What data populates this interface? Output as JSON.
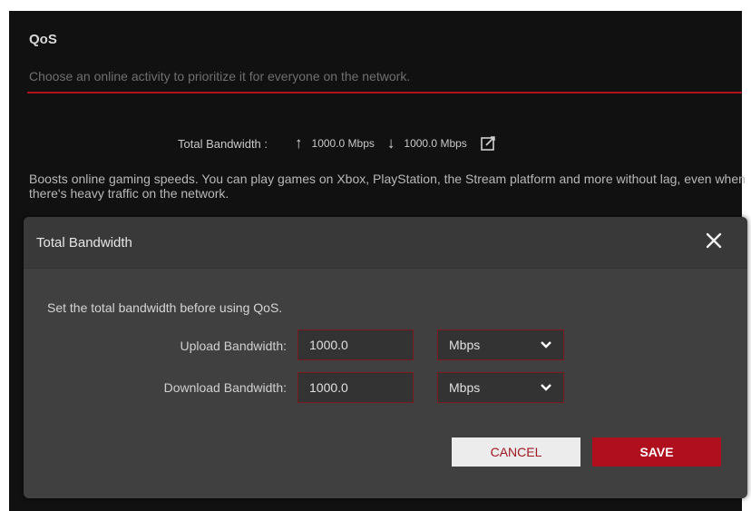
{
  "qos": {
    "title": "QoS",
    "subtitle": "Choose an online activity to prioritize it for everyone on the network.",
    "bandwidth_label": "Total Bandwidth :",
    "upload_value": "1000.0 Mbps",
    "download_value": "1000.0 Mbps",
    "description": "Boosts online gaming speeds. You can play games on Xbox, PlayStation, the Stream platform and more without lag, even when there's heavy traffic on the network."
  },
  "dialog": {
    "title": "Total Bandwidth",
    "note": "Set the total bandwidth before using QoS.",
    "upload_label": "Upload Bandwidth:",
    "upload_value": "1000.0",
    "upload_unit": "Mbps",
    "download_label": "Download Bandwidth:",
    "download_value": "1000.0",
    "download_unit": "Mbps",
    "cancel_label": "CANCEL",
    "save_label": "SAVE"
  },
  "colors": {
    "accent": "#b00f1e",
    "background": "#111111",
    "dialog_bg": "#404040"
  },
  "icons": [
    "arrow-up-icon",
    "arrow-down-icon",
    "edit-icon",
    "close-icon",
    "chevron-down-icon"
  ]
}
